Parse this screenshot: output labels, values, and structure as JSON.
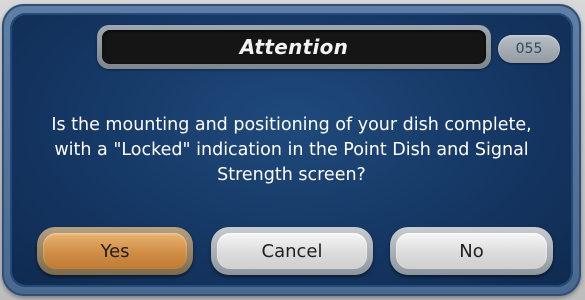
{
  "dialog": {
    "title": "Attention",
    "screen_code": "055",
    "message_lines": [
      "Is the mounting and positioning of your dish complete,",
      "with a \"Locked\" indication in the Point Dish and Signal",
      "Strength screen?"
    ]
  },
  "buttons": {
    "yes_label": "Yes",
    "cancel_label": "Cancel",
    "no_label": "No",
    "selected": "Yes"
  },
  "colors": {
    "dialog_background": "#153764",
    "frame": "#5f7fa7",
    "title_bar": "#151515",
    "selected_button": "#d08d45",
    "button": "#e6e6e6"
  }
}
